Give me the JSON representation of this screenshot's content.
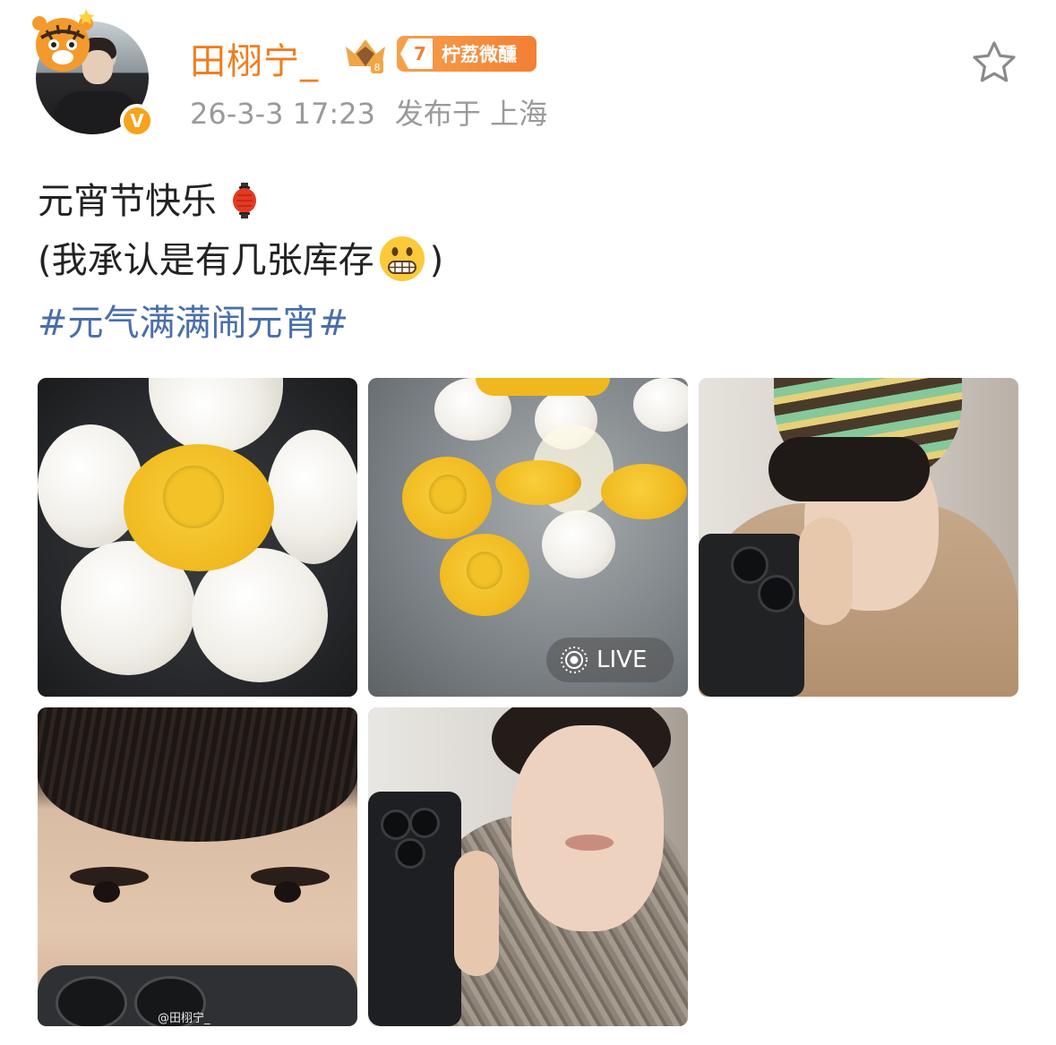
{
  "post": {
    "author": {
      "name": "田栩宁_",
      "level": "7",
      "level_label": "柠荔微醺",
      "verified_mark": "V"
    },
    "time": "26-3-3 17:23",
    "location": "发布于 上海",
    "text_line1": "元宵节快乐",
    "text_line2_open": "(我承认是有几张库存",
    "text_line2_close": ")",
    "hashtag": "#元气满满闹元宵#",
    "live_label": "LIVE",
    "watermark": "@田栩宁_"
  },
  "colors": {
    "username": "#f07d1f",
    "hashtag": "#4a6ea9",
    "meta": "#9a9a9a",
    "level_tag": "#f37f33"
  },
  "icons": [
    "tiger-avatar-frame-icon",
    "verified-icon",
    "crown-badge-icon",
    "star-icon",
    "lantern-emoji-icon",
    "grimace-emoji-icon",
    "live-photo-icon"
  ]
}
